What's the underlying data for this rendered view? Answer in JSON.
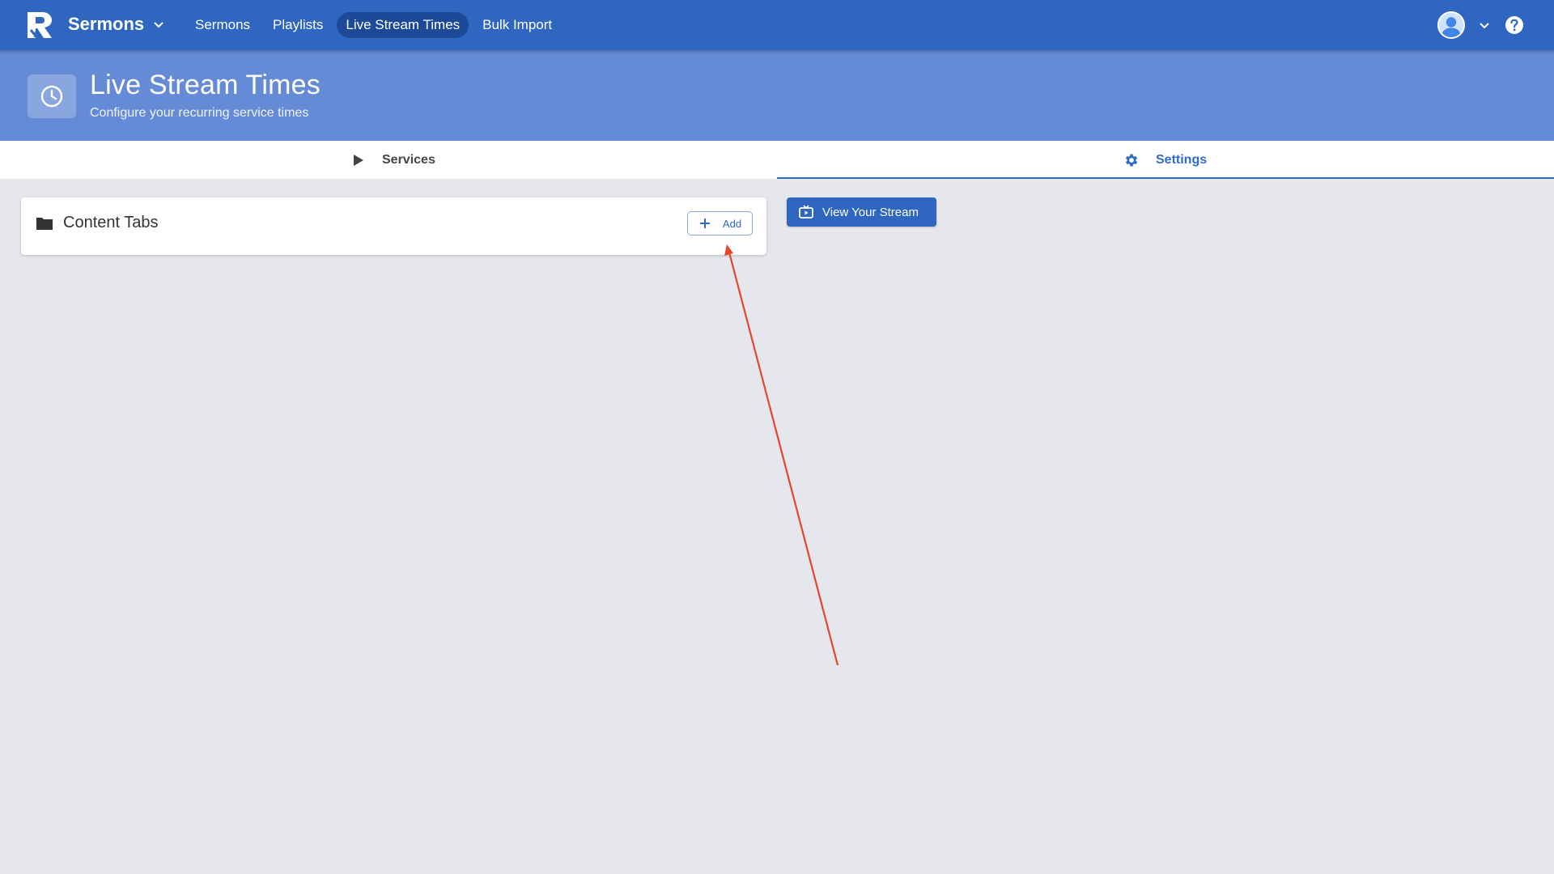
{
  "topbar": {
    "app_name": "Sermons",
    "nav": [
      {
        "label": "Sermons",
        "active": false
      },
      {
        "label": "Playlists",
        "active": false
      },
      {
        "label": "Live Stream Times",
        "active": true
      },
      {
        "label": "Bulk Import",
        "active": false
      }
    ],
    "icons": {
      "logo": "brand-logo",
      "app_chevron": "chevron-down-icon",
      "avatar": "user-avatar-icon",
      "user_chevron": "chevron-down-icon",
      "help": "help-circle-icon"
    }
  },
  "header": {
    "title": "Live Stream Times",
    "subtitle": "Configure your recurring service times",
    "icon": "clock-icon"
  },
  "tabs": [
    {
      "label": "Services",
      "icon": "play-icon",
      "active": false
    },
    {
      "label": "Settings",
      "icon": "gear-icon",
      "active": true
    }
  ],
  "content_card": {
    "title": "Content Tabs",
    "icon": "folder-icon",
    "add_label": "Add",
    "add_icon": "plus-icon"
  },
  "view_stream": {
    "label": "View Your Stream",
    "icon": "tv-play-icon"
  },
  "colors": {
    "topbar": "#2f66c0",
    "header": "#668bd6",
    "accent": "#2f6bc7",
    "background": "#e6e7ec",
    "annotation_arrow": "#e8442e"
  }
}
